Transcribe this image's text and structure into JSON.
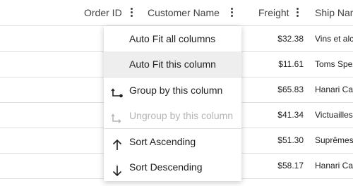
{
  "header": {
    "columns": [
      {
        "label": "Order ID"
      },
      {
        "label": "Customer Name"
      },
      {
        "label": "Freight"
      },
      {
        "label": "Ship Name"
      }
    ]
  },
  "rows": [
    {
      "freight": "$32.38",
      "ship": "Vins et alcools Chevalier"
    },
    {
      "freight": "$11.61",
      "ship": "Toms Spezialitäten"
    },
    {
      "freight": "$65.83",
      "ship": "Hanari Carnes"
    },
    {
      "freight": "$41.34",
      "ship": "Victuailles en stock"
    },
    {
      "freight": "$51.30",
      "ship": "Suprêmes délices"
    },
    {
      "freight": "$58.17",
      "ship": "Hanari Carnes"
    }
  ],
  "column_menu": {
    "items": [
      {
        "label": "Auto Fit all columns",
        "icon": "none",
        "state": "normal"
      },
      {
        "label": "Auto Fit this column",
        "icon": "none",
        "state": "hover"
      },
      {
        "label": "Group by this column",
        "icon": "group-icon",
        "state": "normal"
      },
      {
        "label": "Ungroup by this column",
        "icon": "ungroup-icon",
        "state": "disabled"
      },
      {
        "label": "Sort Ascending",
        "icon": "arrow-up-icon",
        "state": "normal"
      },
      {
        "label": "Sort Descending",
        "icon": "arrow-down-icon",
        "state": "normal"
      }
    ]
  },
  "colors": {
    "text": "#212121",
    "disabled": "#b5b5b5",
    "hover": "#eeeeee",
    "border": "#e0e0e0"
  }
}
